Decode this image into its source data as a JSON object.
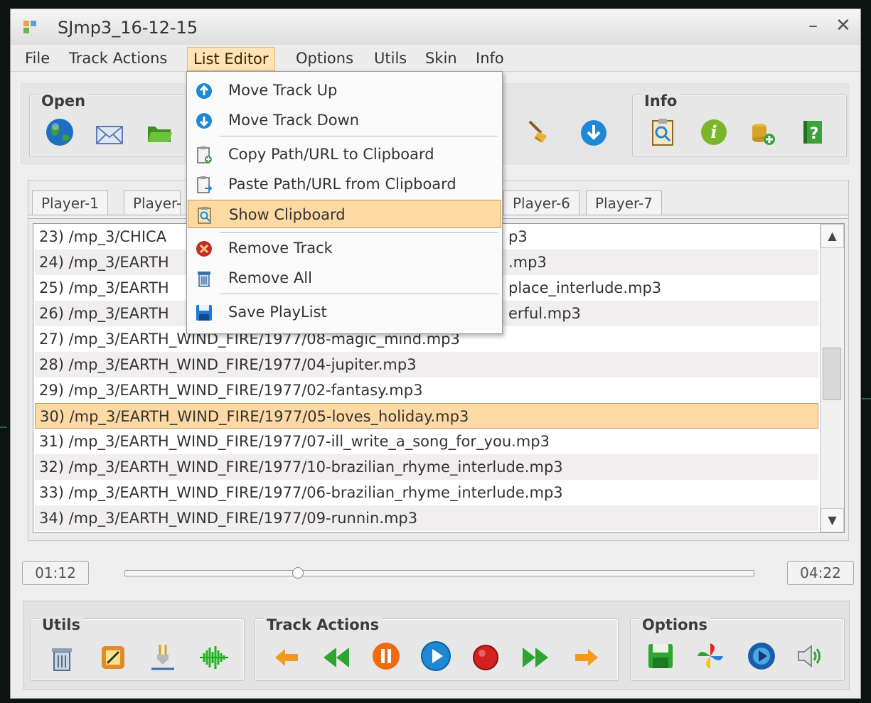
{
  "window": {
    "title": "SJmp3_16-12-15",
    "minimize_glyph": "–",
    "close_glyph": "✕"
  },
  "menubar": {
    "items": [
      {
        "label": "File"
      },
      {
        "label": "Track Actions"
      },
      {
        "label": "List Editor",
        "active": true
      },
      {
        "label": "Options"
      },
      {
        "label": "Utils"
      },
      {
        "label": "Skin"
      },
      {
        "label": "Info"
      }
    ]
  },
  "toolbar": {
    "open": {
      "title": "Open",
      "icons": [
        "globe-icon",
        "mail-icon",
        "folder-icon"
      ]
    },
    "list": {
      "icons": [
        "broom-icon",
        "download-icon"
      ]
    },
    "info": {
      "title": "Info",
      "icons": [
        "clipboard-search-icon",
        "info-icon",
        "coins-add-icon",
        "help-book-icon"
      ]
    }
  },
  "tabs": [
    {
      "label": "Player-1"
    },
    {
      "label": "Player-"
    },
    {
      "label": "Player-6"
    },
    {
      "label": "Player-7"
    }
  ],
  "playlist": {
    "rows": [
      "23) /mp_3/CHICA",
      "24) /mp_3/EARTH",
      "25) /mp_3/EARTH",
      "26) /mp_3/EARTH",
      "27) /mp_3/EARTH_WIND_FIRE/1977/08-magic_mind.mp3",
      "28) /mp_3/EARTH_WIND_FIRE/1977/04-jupiter.mp3",
      "29) /mp_3/EARTH_WIND_FIRE/1977/02-fantasy.mp3",
      "30) /mp_3/EARTH_WIND_FIRE/1977/05-loves_holiday.mp3",
      "31) /mp_3/EARTH_WIND_FIRE/1977/07-ill_write_a_song_for_you.mp3",
      "32) /mp_3/EARTH_WIND_FIRE/1977/10-brazilian_rhyme_interlude.mp3",
      "33) /mp_3/EARTH_WIND_FIRE/1977/06-brazilian_rhyme_interlude.mp3",
      "34) /mp_3/EARTH_WIND_FIRE/1977/09-runnin.mp3"
    ],
    "row_tails": [
      "p3",
      ".mp3",
      "place_interlude.mp3",
      "erful.mp3"
    ],
    "selected_index": 7
  },
  "playback": {
    "elapsed": "01:12",
    "total": "04:22",
    "progress": 0.275
  },
  "bottom": {
    "utils": {
      "title": "Utils",
      "icons": [
        "trash-icon",
        "edit-icon",
        "plug-icon",
        "waveform-icon"
      ]
    },
    "track_actions": {
      "title": "Track Actions",
      "icons": [
        "arrow-left-icon",
        "rewind-icon",
        "pause-icon",
        "play-icon",
        "record-icon",
        "fast-forward-icon",
        "arrow-right-icon"
      ]
    },
    "options": {
      "title": "Options",
      "icons": [
        "save-icon",
        "pinwheel-icon",
        "settings-circle-icon",
        "volume-icon"
      ]
    }
  },
  "list_editor_menu": {
    "items": [
      {
        "label": "Move Track Up",
        "icon": "arrow-up-icon"
      },
      {
        "label": "Move Track Down",
        "icon": "arrow-down-icon"
      },
      {
        "label": "Copy Path/URL to Clipboard",
        "icon": "clipboard-copy-icon"
      },
      {
        "label": "Paste Path/URL from Clipboard",
        "icon": "clipboard-paste-icon"
      },
      {
        "label": "Show Clipboard",
        "icon": "clipboard-search-icon",
        "highlighted": true
      },
      {
        "label": "Remove Track",
        "icon": "remove-icon"
      },
      {
        "label": "Remove All",
        "icon": "trash-icon"
      },
      {
        "label": "Save PlayList",
        "icon": "floppy-icon"
      }
    ]
  },
  "colors": {
    "selection": "#fdd9a4",
    "window_bg": "#eeeeee",
    "accent_blue": "#1e88d6"
  }
}
